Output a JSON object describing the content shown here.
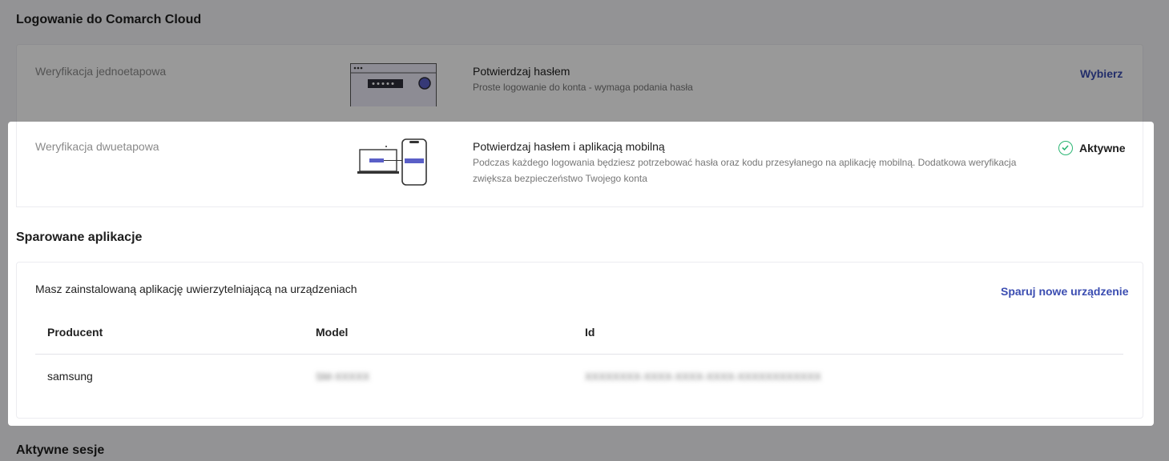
{
  "login": {
    "title": "Logowanie do Comarch Cloud",
    "single": {
      "label": "Weryfikacja jednoetapowa",
      "option_title": "Potwierdzaj hasłem",
      "option_desc": "Proste logowanie do konta - wymaga podania hasła",
      "action": "Wybierz"
    },
    "double": {
      "label": "Weryfikacja dwuetapowa",
      "option_title": "Potwierdzaj hasłem i aplikacją mobilną",
      "option_desc_line1": "Podczas każdego logowania będziesz potrzebować hasła oraz kodu przesyłanego na aplikację mobilną. Dodatkowa weryfikacja",
      "option_desc_line2": "zwiększa bezpieczeństwo Twojego konta",
      "status": "Aktywne"
    }
  },
  "paired": {
    "title": "Sparowane aplikacje",
    "info": "Masz zainstalowaną aplikację uwierzytelniającą na urządzeniach",
    "action": "Sparuj nowe urządzenie",
    "table": {
      "headers": [
        "Producent",
        "Model",
        "Id"
      ],
      "rows": [
        [
          "samsung",
          "SM-XXXXX",
          "XXXXXXXX-XXXX-XXXX-XXXX-XXXXXXXXXXXX"
        ]
      ]
    }
  },
  "sessions": {
    "title": "Aktywne sesje"
  },
  "colors": {
    "accent": "#3b4db1",
    "success": "#2bb673",
    "illustration": "#5a5fc7"
  }
}
